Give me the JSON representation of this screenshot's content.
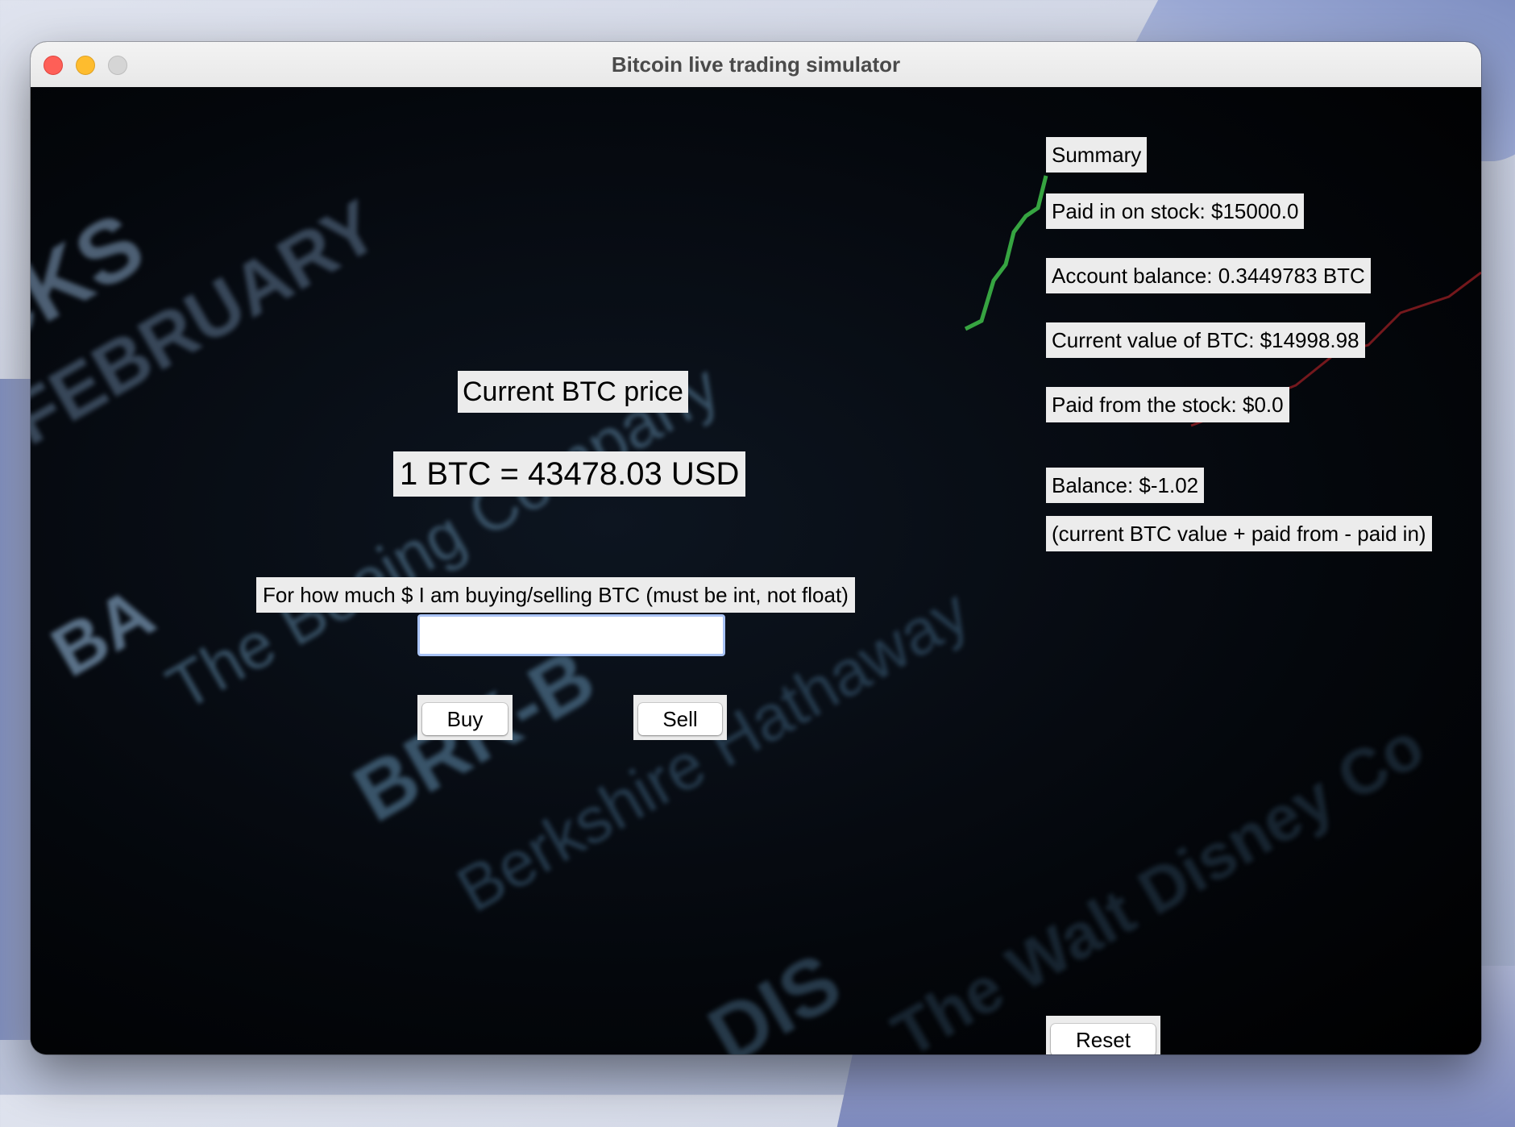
{
  "window": {
    "title": "Bitcoin live trading simulator"
  },
  "price_panel": {
    "heading": "Current BTC price",
    "price_line": "1 BTC = 43478.03 USD"
  },
  "trade": {
    "amount_label": "For how much $ I am buying/selling BTC (must be int, not float)",
    "amount_value": "",
    "buy_label": "Buy",
    "sell_label": "Sell"
  },
  "summary": {
    "heading": "Summary",
    "paid_in": "Paid in on stock: $15000.0",
    "account_balance": "Account balance: 0.3449783 BTC",
    "current_value": "Current value of BTC: $14998.98",
    "paid_from": "Paid from the stock: $0.0",
    "balance": "Balance: $-1.02",
    "formula": "(current BTC value + paid from - paid in)",
    "reset_label": "Reset"
  },
  "colors": {
    "label_bg": "#ececec",
    "focus_ring": "#a9c3f5",
    "chart_green": "#3fbf4a",
    "chart_red": "#c0242a"
  }
}
